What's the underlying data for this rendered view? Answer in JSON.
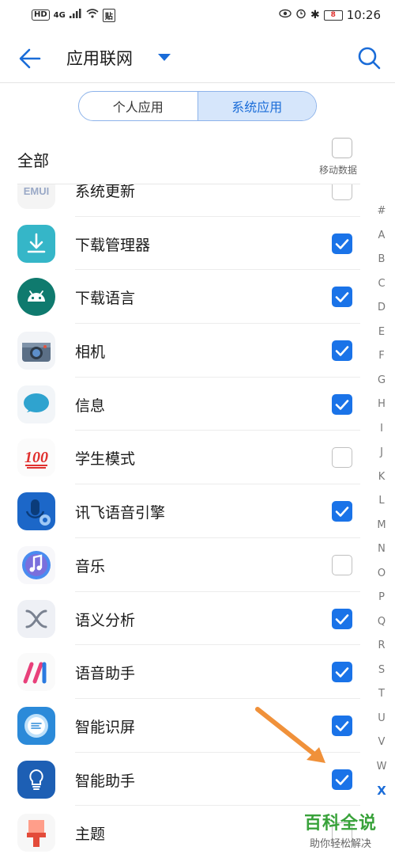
{
  "status_bar": {
    "hd": "HD",
    "network": "4G",
    "sim_tag": "贴",
    "battery": "8",
    "time": "10:26"
  },
  "header": {
    "title": "应用联网",
    "accent_color": "#1a6cd8"
  },
  "tabs": [
    {
      "label": "个人应用",
      "active": false
    },
    {
      "label": "系统应用",
      "active": true
    }
  ],
  "select_all": {
    "label": "全部",
    "mobile_data_label": "移动数据",
    "checked": false
  },
  "apps": [
    {
      "name": "系统更新",
      "icon": "emui-icon",
      "checked": false
    },
    {
      "name": "下载管理器",
      "icon": "download-manager-icon",
      "checked": true
    },
    {
      "name": "下载语言",
      "icon": "android-icon",
      "checked": true
    },
    {
      "name": "相机",
      "icon": "camera-icon",
      "checked": true
    },
    {
      "name": "信息",
      "icon": "message-icon",
      "checked": true
    },
    {
      "name": "学生模式",
      "icon": "hundred-points-icon",
      "checked": false
    },
    {
      "name": "讯飞语音引擎",
      "icon": "iflytek-voice-icon",
      "checked": true
    },
    {
      "name": "音乐",
      "icon": "music-icon",
      "checked": false
    },
    {
      "name": "语义分析",
      "icon": "semantic-analysis-icon",
      "checked": true
    },
    {
      "name": "语音助手",
      "icon": "voice-assistant-icon",
      "checked": true
    },
    {
      "name": "智能识屏",
      "icon": "smart-screen-icon",
      "checked": true
    },
    {
      "name": "智能助手",
      "icon": "smart-assistant-icon",
      "checked": true
    },
    {
      "name": "主题",
      "icon": "themes-icon",
      "checked": false
    }
  ],
  "alphabet_index": [
    "#",
    "A",
    "B",
    "C",
    "D",
    "E",
    "F",
    "G",
    "H",
    "I",
    "J",
    "K",
    "L",
    "M",
    "N",
    "O",
    "P",
    "Q",
    "R",
    "S",
    "T",
    "U",
    "V",
    "W",
    "X"
  ],
  "alphabet_current": "X",
  "watermark": {
    "title": "百科全说",
    "subtitle": "助你轻松解决"
  },
  "colors": {
    "checkbox_on": "#1a73e8",
    "annotation_arrow": "#f0913a",
    "watermark_green": "#38a23a"
  }
}
